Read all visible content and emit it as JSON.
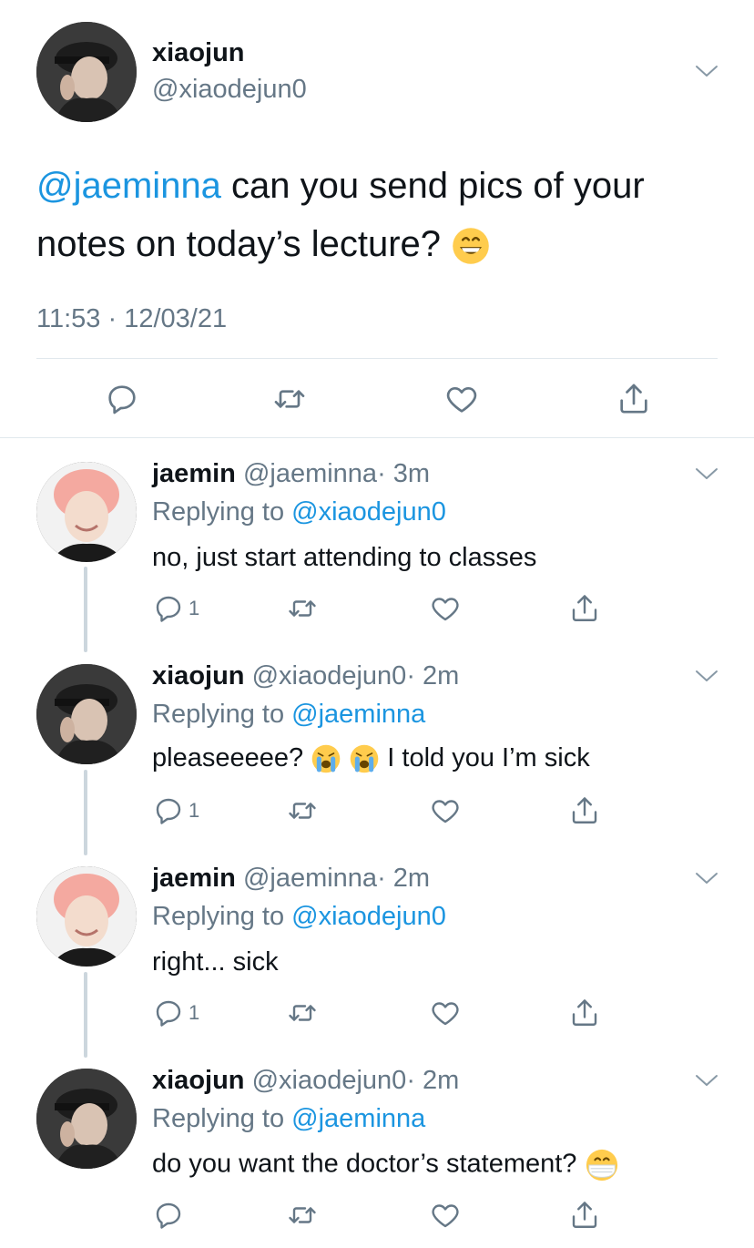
{
  "main_tweet": {
    "name": "xiaojun",
    "handle": "@xiaodejun0",
    "mention": "@jaeminna",
    "text_line1": " can you send pics of your",
    "text_line2": "notes on today’s lecture?",
    "emoji": "grinning-face",
    "timestamp": "11:53 · 12/03/21"
  },
  "replies": [
    {
      "name": "jaemin",
      "handle": "@jaeminna",
      "time": "· 3m",
      "replying_label": "Replying to ",
      "replying_to": "@xiaodejun0",
      "text": "no, just start attending to classes",
      "reply_count": "1",
      "avatar": "pink-hair"
    },
    {
      "name": "xiaojun",
      "handle": "@xiaodejun0",
      "time": "· 2m",
      "replying_label": "Replying to ",
      "replying_to": "@jaeminna",
      "text_before": "pleaseeeee?",
      "text_after": "I told you I’m sick",
      "reply_count": "1",
      "avatar": "black-cap"
    },
    {
      "name": "jaemin",
      "handle": "@jaeminna",
      "time": "· 2m",
      "replying_label": "Replying to ",
      "replying_to": "@xiaodejun0",
      "text": "right... sick",
      "reply_count": "1",
      "avatar": "pink-hair"
    },
    {
      "name": "xiaojun",
      "handle": "@xiaodejun0",
      "time": "· 2m",
      "replying_label": "Replying to ",
      "replying_to": "@jaeminna",
      "text": "do you want the doctor’s statement?",
      "emoji": "face-with-medical-mask",
      "reply_count": "",
      "avatar": "black-cap"
    }
  ],
  "colors": {
    "link": "#1b95e0",
    "muted": "#657786",
    "divider": "#e1e8ed"
  }
}
